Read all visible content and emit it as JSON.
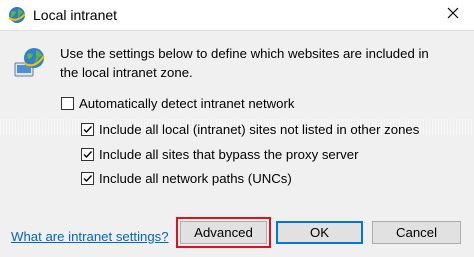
{
  "window": {
    "title": "Local intranet",
    "title_icon": "globe-icon",
    "close_icon": "close-icon"
  },
  "zone_icon": "intranet-globe-icon",
  "description": {
    "line1": "Use the settings below to define which websites are included in",
    "line2": "the local intranet zone."
  },
  "options": [
    {
      "label": "Automatically detect intranet network",
      "checked": false
    },
    {
      "label": "Include all local (intranet) sites not listed in other zones",
      "checked": true
    },
    {
      "label": "Include all sites that bypass the proxy server",
      "checked": true
    },
    {
      "label": "Include all network paths (UNCs)",
      "checked": true
    }
  ],
  "help_link": "What are intranet settings?",
  "buttons": {
    "advanced": "Advanced",
    "ok": "OK",
    "cancel": "Cancel"
  },
  "colors": {
    "link": "#0066cc",
    "highlight": "#e0111b",
    "default_button_border": "#0078d7"
  }
}
